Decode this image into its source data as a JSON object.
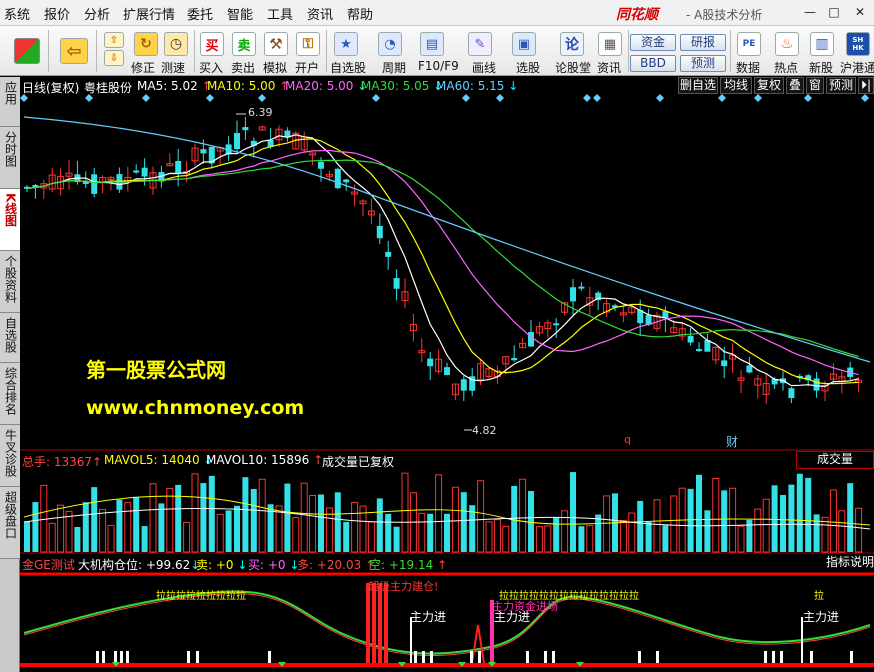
{
  "menubar": {
    "items": [
      "系统",
      "报价",
      "分析",
      "扩展行情",
      "委托",
      "智能",
      "工具",
      "资讯",
      "帮助"
    ],
    "brand": "同花顺",
    "brand_sub": "- A股技术分析",
    "win_buttons": [
      "—",
      "□",
      "✕"
    ]
  },
  "toolbar": {
    "left_buttons": [
      "修正",
      "测速"
    ],
    "trade_buttons": [
      "买入",
      "卖出",
      "模拟",
      "开户"
    ],
    "view_buttons": [
      "自选股",
      "周期",
      "F10/F9",
      "画线",
      "选股",
      "论股堂",
      "资讯"
    ],
    "pill_buttons": [
      "资金",
      "研报",
      "BBD",
      "预测"
    ],
    "right_buttons": [
      "数据",
      "热点",
      "新股",
      "沪港通"
    ]
  },
  "sidetabs": [
    {
      "label": "应用",
      "active": false
    },
    {
      "label": "分时图",
      "active": false
    },
    {
      "label": "K线图",
      "active": true
    },
    {
      "label": "个股资料",
      "active": false
    },
    {
      "label": "自选股",
      "active": false
    },
    {
      "label": "综合排名",
      "active": false
    },
    {
      "label": "牛叉诊股",
      "active": false
    },
    {
      "label": "超级盘口",
      "active": false
    }
  ],
  "kline_header": {
    "period": "日线(复权)",
    "stock_name": "粤桂股份",
    "ma": [
      {
        "label": "MA5: 5.02",
        "arrow": "↑",
        "color": "#ffffff"
      },
      {
        "label": "MA10: 5.00",
        "arrow": "↑",
        "color": "#ffff00"
      },
      {
        "label": "MA20: 5.00",
        "arrow": "↓",
        "color": "#ff66ff"
      },
      {
        "label": "MA30: 5.05",
        "arrow": "↓",
        "color": "#33dd33"
      },
      {
        "label": "MA60: 5.15",
        "arrow": "↓",
        "color": "#66ccff"
      }
    ]
  },
  "right_buttons": [
    "删自选",
    "均线",
    "复权",
    "叠",
    "窗",
    "预测",
    "⏵|"
  ],
  "kline": {
    "high_label": "6.39",
    "low_label": "4.82",
    "marker_q": "q",
    "marker_cai": "财"
  },
  "volume_header": {
    "total": "总手: 13367",
    "total_arrow": "↑",
    "mavol5": "MAVOL5: 14040",
    "mavol5_arrow": "↓",
    "mavol10": "MAVOL10: 15896",
    "mavol10_arrow": "↑",
    "note": "成交量已复权",
    "right_button": "成交量"
  },
  "indicator_header": {
    "name": "金GE测试",
    "parts": [
      {
        "label": "大机构仓位: +99.62",
        "arrow": "↓",
        "color": "#ffffff"
      },
      {
        "label": "卖: +0",
        "arrow": "↓",
        "color": "#ffff00"
      },
      {
        "label": "买: +0",
        "arrow": "↓",
        "color": "#ff66ff"
      },
      {
        "label": "多: +20.03",
        "arrow": "↑",
        "color": "#ff4444"
      },
      {
        "label": "空: +19.14",
        "arrow": "↑",
        "color": "#33dd33"
      }
    ],
    "right_button": "指标说明"
  },
  "indicator_labels": {
    "super_build": "超级主力建仓!",
    "main_in_1": "主力进",
    "main_in_2": "主力进",
    "main_in_3": "主力进",
    "la_1": "拉拉拉拉拉",
    "la_2": "拉拉拉拉",
    "la_3": "拉拉拉拉拉拉拉拉拉拉拉拉拉拉",
    "la_4": "拉",
    "pink": "主力资金进场"
  },
  "watermark": {
    "line1": "第一股票公式网",
    "line2": "www.chnmoney.com"
  }
}
